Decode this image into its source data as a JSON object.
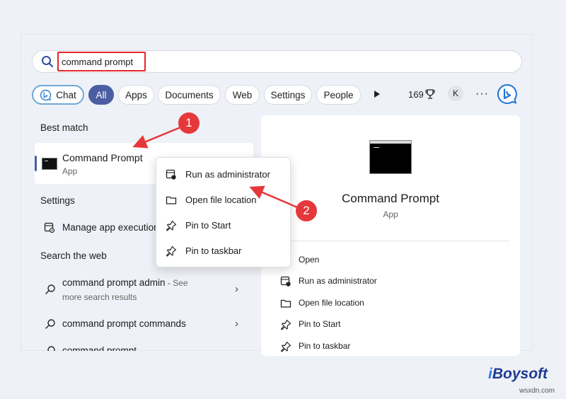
{
  "search": {
    "value": "command prompt"
  },
  "filters": {
    "chat": "Chat",
    "all": "All",
    "apps": "Apps",
    "documents": "Documents",
    "web": "Web",
    "settings": "Settings",
    "people": "People"
  },
  "toolbar": {
    "points": "169",
    "avatar": "K",
    "more": "···"
  },
  "best_match": {
    "heading": "Best match",
    "title": "Command Prompt",
    "subtitle": "App"
  },
  "settings_section": {
    "heading": "Settings",
    "item": "Manage app execution aliases"
  },
  "web_section": {
    "heading": "Search the web",
    "item1_bold": "command prompt admin",
    "item1_suffix": " - See",
    "item1_sub": "more search results",
    "item2_prefix": "command prompt ",
    "item2_bold": "commands",
    "item3": "command prompt"
  },
  "context_menu": {
    "items": [
      "Run as administrator",
      "Open file location",
      "Pin to Start",
      "Pin to taskbar"
    ]
  },
  "detail": {
    "title": "Command Prompt",
    "subtitle": "App",
    "actions": [
      "Open",
      "Run as administrator",
      "Open file location",
      "Pin to Start",
      "Pin to taskbar"
    ]
  },
  "annotations": {
    "badge1": "1",
    "badge2": "2",
    "color": "#e5383b"
  },
  "brand": {
    "logo_prefix": "i",
    "logo_rest": "Boysoft",
    "watermark": "wsxdn.com"
  }
}
